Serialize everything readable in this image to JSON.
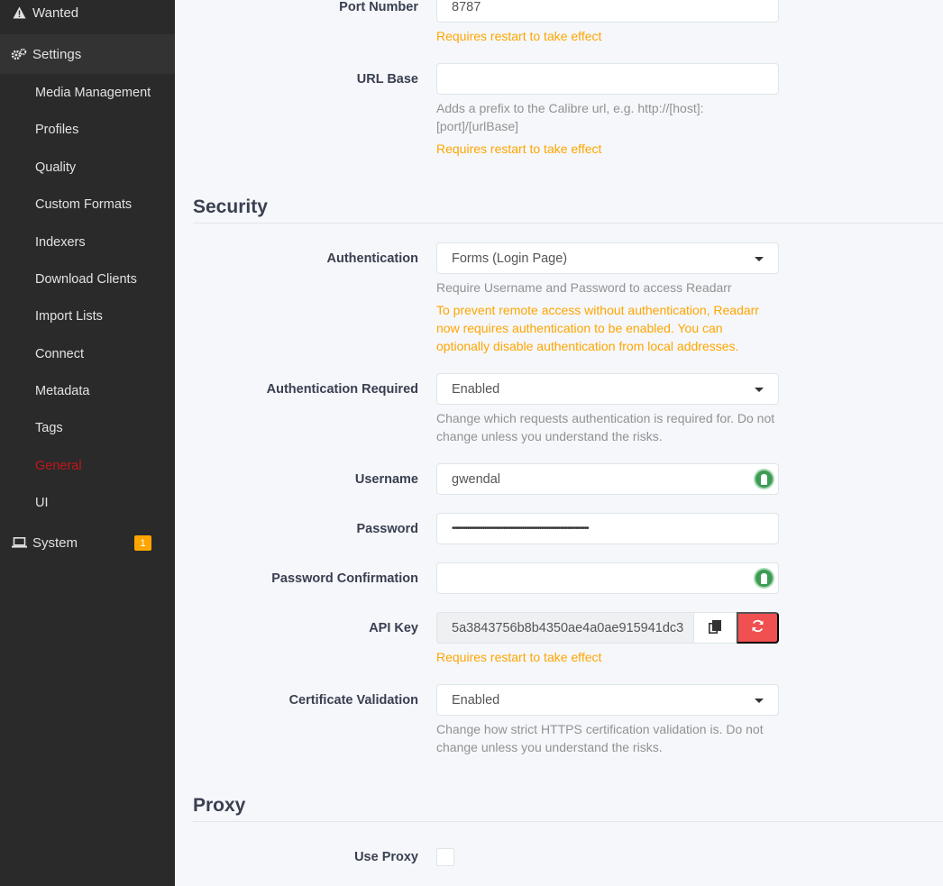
{
  "sidebar": {
    "wanted": "Wanted",
    "settings": "Settings",
    "items": [
      "Media Management",
      "Profiles",
      "Quality",
      "Custom Formats",
      "Indexers",
      "Download Clients",
      "Import Lists",
      "Connect",
      "Metadata",
      "Tags",
      "General",
      "UI"
    ],
    "current_item": "General",
    "system": "System",
    "system_badge": "1"
  },
  "host": {
    "port_label": "Port Number",
    "port_value": "8787",
    "port_warning": "Requires restart to take effect",
    "urlbase_label": "URL Base",
    "urlbase_value": "",
    "urlbase_help": "Adds a prefix to the Calibre url, e.g. http://[host]:[port]/[urlBase]",
    "urlbase_warning": "Requires restart to take effect"
  },
  "security": {
    "title": "Security",
    "auth_label": "Authentication",
    "auth_value": "Forms (Login Page)",
    "auth_help": "Require Username and Password to access Readarr",
    "auth_warning": "To prevent remote access without authentication, Readarr now requires authentication to be enabled. You can optionally disable authentication from local addresses.",
    "auth_required_label": "Authentication Required",
    "auth_required_value": "Enabled",
    "auth_required_help": "Change which requests authentication is required for. Do not change unless you understand the risks.",
    "username_label": "Username",
    "username_value": "gwendal",
    "password_label": "Password",
    "password_value": "••••••••••••••••••••••••••••••••••••••••••••••••••••••••••••••••••••••••",
    "password_confirm_label": "Password Confirmation",
    "password_confirm_value": "",
    "api_key_label": "API Key",
    "api_key_value": "5a3843756b8b4350ae4a0ae915941dc3",
    "api_key_warning": "Requires restart to take effect",
    "cert_label": "Certificate Validation",
    "cert_value": "Enabled",
    "cert_help": "Change how strict HTTPS certification validation is. Do not change unless you understand the risks."
  },
  "proxy": {
    "title": "Proxy",
    "use_proxy_label": "Use Proxy"
  },
  "colors": {
    "accent_red": "#c0161c",
    "warning": "#ffa500",
    "danger": "#f05050",
    "lastpass_green": "#3c9c53"
  },
  "icons": {
    "wanted": "warning-triangle-icon",
    "settings": "gears-icon",
    "system": "laptop-icon",
    "copy": "copy-icon",
    "regenerate": "refresh-icon",
    "password_manager": "lastpass-icon"
  }
}
